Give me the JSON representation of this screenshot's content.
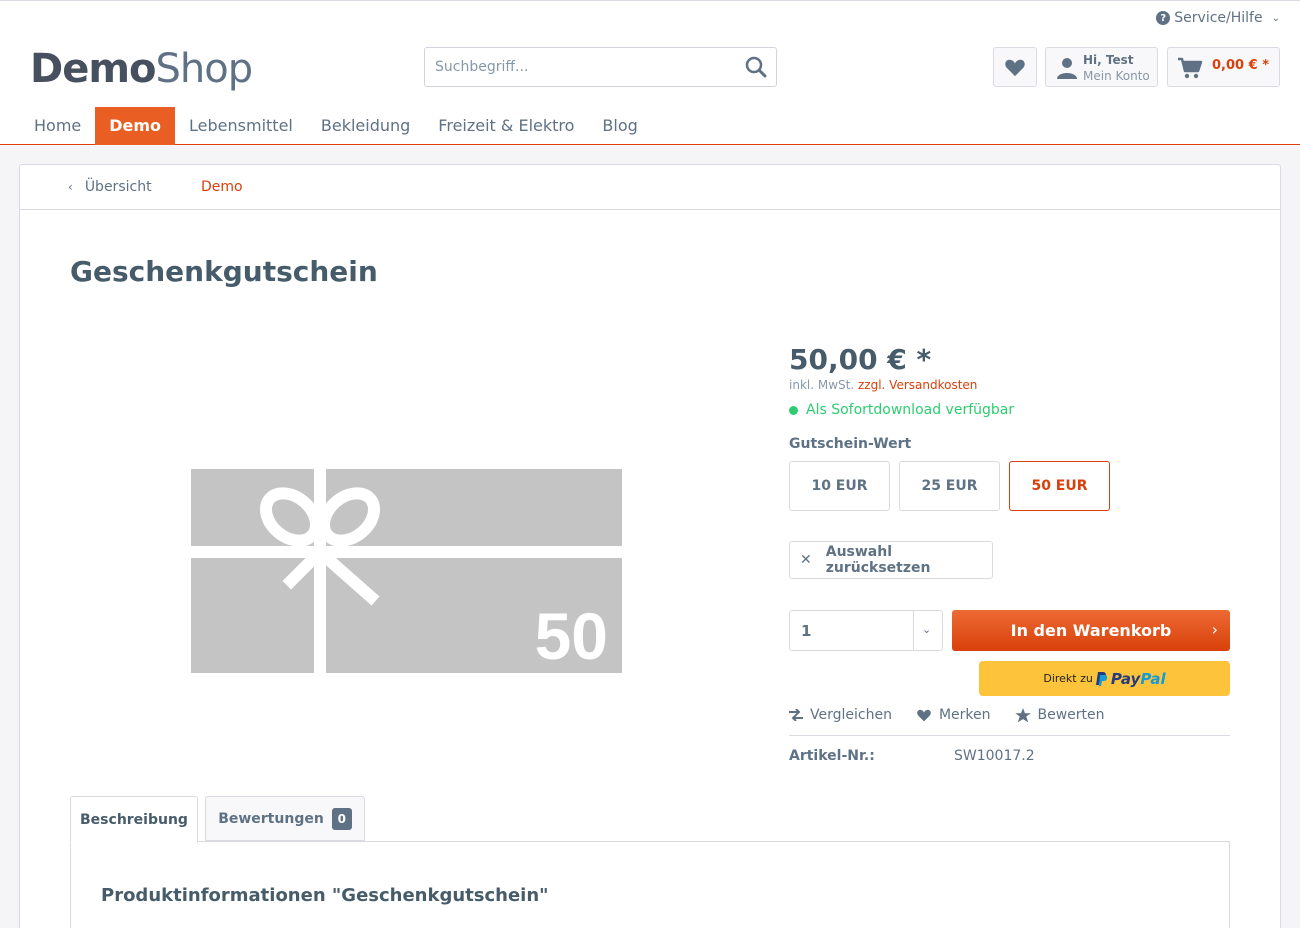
{
  "header": {
    "service_label": "Service/Hilfe",
    "logo_bold": "Demo",
    "logo_light": "Shop",
    "search_placeholder": "Suchbegriff...",
    "account_line1": "Hi, Test",
    "account_line2": "Mein Konto",
    "cart_amount": "0,00 € *"
  },
  "nav": {
    "items": [
      {
        "label": "Home"
      },
      {
        "label": "Demo"
      },
      {
        "label": "Lebensmittel"
      },
      {
        "label": "Bekleidung"
      },
      {
        "label": "Freizeit & Elektro"
      },
      {
        "label": "Blog"
      }
    ],
    "active": "Demo"
  },
  "breadcrumb": {
    "back_label": "Übersicht",
    "category": "Demo"
  },
  "product": {
    "title": "Geschenkgutschein",
    "image_number": "50",
    "price": "50,00 € *",
    "tax_note": "inkl. MwSt.",
    "shipping_link": "zzgl. Versandkosten",
    "availability": "Als Sofortdownload verfügbar",
    "config_label": "Gutschein-Wert",
    "options": [
      {
        "label": "10 EUR"
      },
      {
        "label": "25 EUR"
      },
      {
        "label": "50 EUR"
      }
    ],
    "selected_option": "50 EUR",
    "reset_label": "Auswahl zurücksetzen",
    "quantity": "1",
    "add_to_cart": "In den Warenkorb",
    "paypal_prefix": "Direkt zu",
    "paypal_pay": "Pay",
    "paypal_pal": "Pal",
    "actions": {
      "compare": "Vergleichen",
      "note": "Merken",
      "rate": "Bewerten"
    },
    "article_label": "Artikel-Nr.:",
    "article_number": "SW10017.2"
  },
  "tabs": {
    "description": "Beschreibung",
    "reviews": "Bewertungen",
    "reviews_count": "0",
    "description_title": "Produktinformationen \"Geschenkgutschein\""
  },
  "colors": {
    "accent": "#d9400b",
    "accent_button": "#e95f23",
    "available": "#2ecc71",
    "paypal": "#fdc43b"
  }
}
